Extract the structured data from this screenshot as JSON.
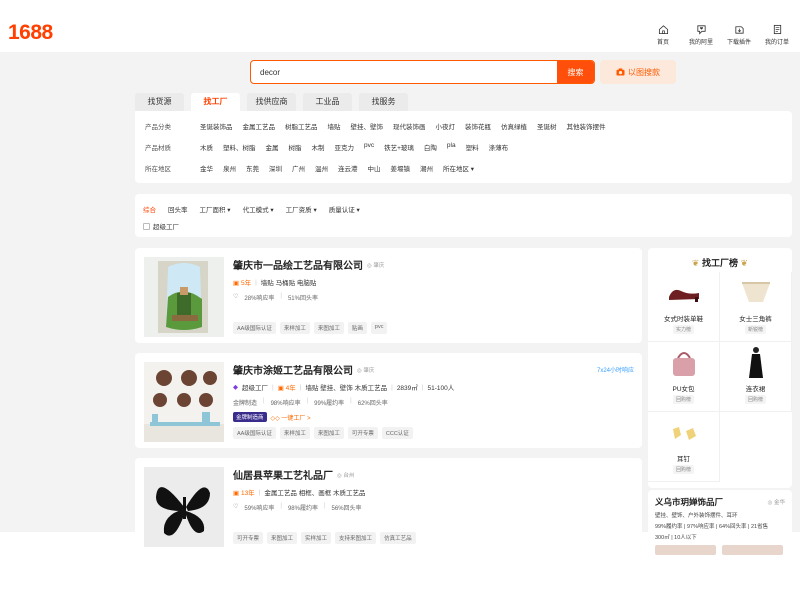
{
  "header": {
    "logo": "1688",
    "nav": [
      {
        "label": "首页",
        "icon": "home-icon"
      },
      {
        "label": "我的阿里",
        "icon": "heart-chat-icon"
      },
      {
        "label": "下载插件",
        "icon": "download-icon"
      },
      {
        "label": "我的订单",
        "icon": "order-icon"
      }
    ]
  },
  "search": {
    "value": "decor",
    "button": "搜索",
    "image_search": "以图搜款"
  },
  "tabs": [
    "找货源",
    "找工厂",
    "找供应商",
    "工业品",
    "找服务"
  ],
  "filters": [
    {
      "label": "产品分类",
      "options": [
        "圣诞装饰品",
        "金属工艺品",
        "树脂工艺品",
        "墙贴",
        "壁挂、壁饰",
        "现代装饰画",
        "小夜灯",
        "装饰花瓶",
        "仿真绿植",
        "圣诞树",
        "其他装饰摆件"
      ]
    },
    {
      "label": "产品材质",
      "options": [
        "木质",
        "塑料、树脂",
        "金属",
        "树脂",
        "木制",
        "亚克力",
        "pvc",
        "铁艺+玻璃",
        "白陶",
        "pla",
        "塑料",
        "涤薄布"
      ]
    },
    {
      "label": "所在地区",
      "options": [
        "金华",
        "泉州",
        "东莞",
        "深圳",
        "广州",
        "温州",
        "连云港",
        "中山",
        "姜堰镇",
        "潮州",
        "所在地区 ▾"
      ]
    }
  ],
  "sort": {
    "items": [
      "综合",
      "回头率",
      "工厂面积 ▾",
      "代工模式 ▾",
      "工厂资质 ▾",
      "质量认证 ▾"
    ],
    "checkbox_label": "超级工厂"
  },
  "results": [
    {
      "title": "肇庆市一品绘工艺品有限公司",
      "location": "肇庆",
      "years": "5年",
      "products": "墙贴 马桶贴 电脑贴",
      "stats": [
        "28%响应率",
        "51%回头率"
      ],
      "tags": [
        "AA级国际认证",
        "来样加工",
        "来图加工",
        "贴画",
        "pvc"
      ]
    },
    {
      "title": "肇庆市涂姬工艺品有限公司",
      "location": "肇庆",
      "online": "7x24小时响应",
      "level": "超级工厂",
      "years": "4年",
      "products": "墙贴 壁挂、壁饰 木质工艺品",
      "area": "2839㎡",
      "staff": "51-100人",
      "stats": [
        "金牌制造",
        "98%响应率",
        "99%履约率",
        "62%回头率"
      ],
      "badge": "金牌制造商",
      "badge2": "一键工厂 >",
      "tags": [
        "AA级国际认证",
        "来样加工",
        "来图加工",
        "可开专票",
        "CCC认证"
      ]
    },
    {
      "title": "仙居县苹果工艺礼品厂",
      "location": "台州",
      "years": "13年",
      "products": "金属工艺品 相框、画框 木质工艺品",
      "stats": [
        "59%响应率",
        "98%履约率",
        "56%回头率"
      ],
      "tags": [
        "可开专票",
        "来图加工",
        "实样加工",
        "支持来图加工",
        "仿真工艺品"
      ]
    }
  ],
  "sidebar": {
    "title": "找工厂榜",
    "items": [
      {
        "name": "女式时装单鞋",
        "sub": "实力榜"
      },
      {
        "name": "女士三角裤",
        "sub": "新锐榜"
      },
      {
        "name": "PU女包",
        "sub": "回购榜"
      },
      {
        "name": "连衣裙",
        "sub": "回购榜"
      },
      {
        "name": "耳钉",
        "sub": "回购榜"
      }
    ],
    "card": {
      "title": "义乌市玥婵饰品厂",
      "location": "金华",
      "line1": "壁挂、壁饰、户外装饰摆件、耳环",
      "line2": "99%履约率 | 97%响应率 | 64%回头率 | 21省售",
      "line3": "300㎡ | 10人以下"
    }
  },
  "colors": {
    "brand": "#ff4000",
    "accent": "#ff5a00"
  }
}
